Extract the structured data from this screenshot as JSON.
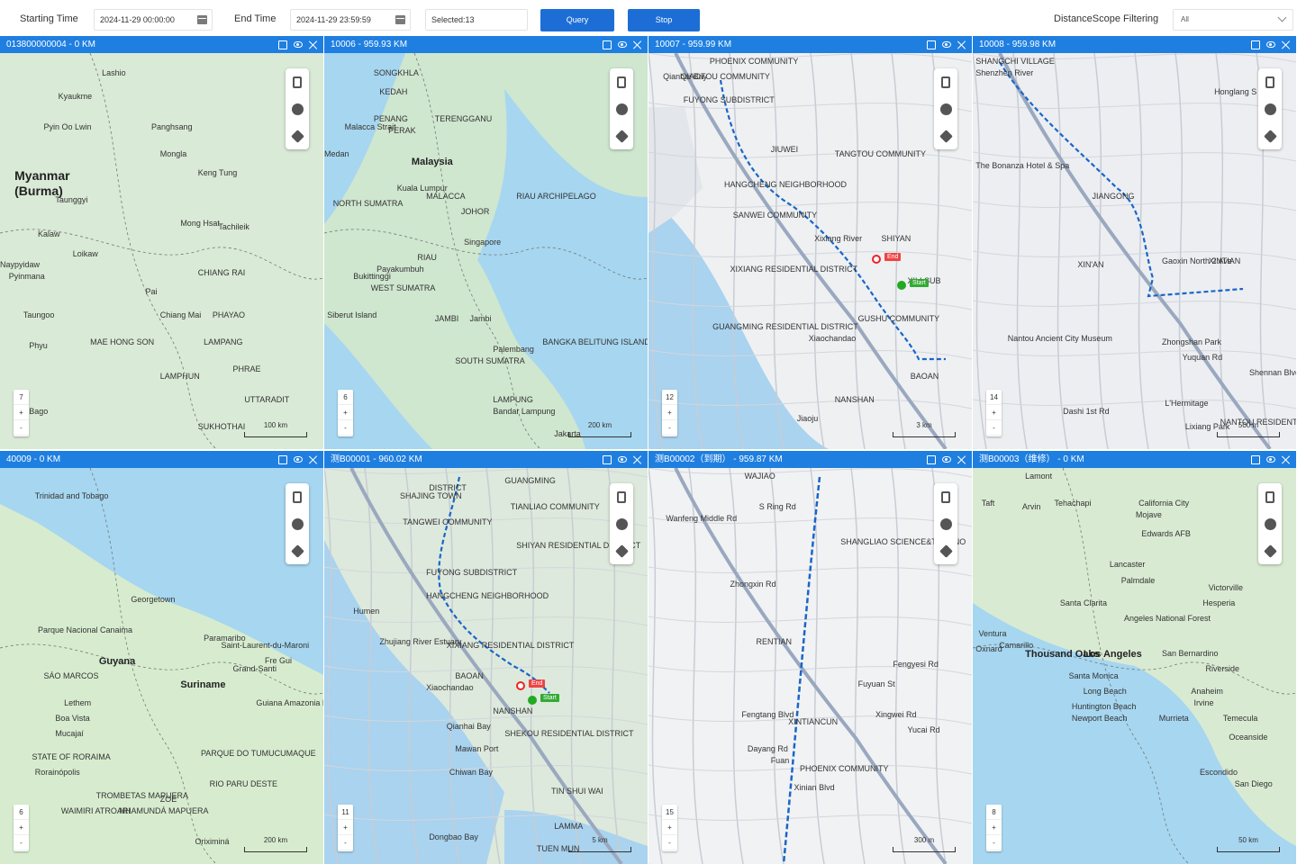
{
  "toolbar": {
    "start_label": "Starting Time",
    "start_value": "2024-11-29 00:00:00",
    "end_label": "End Time",
    "end_value": "2024-11-29 23:59:59",
    "selected": "Selected:13",
    "query": "Query",
    "stop": "Stop",
    "distance_label": "DistanceScope Filtering",
    "distance_value": "All"
  },
  "panels": [
    {
      "title": "013800000004 - 0 KM",
      "zoom": "7",
      "scale": "100 km",
      "labels": [
        "Myanmar",
        "(Burma)",
        "Lashio",
        "Kyaukme",
        "Pyin Oo Lwin",
        "Panghsang",
        "Mongla",
        "Keng Tung",
        "Taunggyi",
        "Mong Hsat",
        "Tachileik",
        "Kalaw",
        "Loikaw",
        "Naypyidaw",
        "Pyinmana",
        "CHIANG RAI",
        "Pai",
        "Chiang Mai",
        "PHAYAO",
        "Taungoo",
        "MAE HONG SON",
        "LAMPANG",
        "Phyu",
        "PHRAE",
        "LAMPHUN",
        "Bago",
        "UTTARADIT",
        "SUKHOTHAI"
      ]
    },
    {
      "title": "10006 - 959.93 KM",
      "zoom": "6",
      "scale": "200 km",
      "labels": [
        "Malaysia",
        "Kuala Lumpur",
        "Singapore",
        "Medan",
        "SONGKHLA",
        "KEDAH",
        "PENANG",
        "TERENGGANU",
        "PERAK",
        "NORTH SUMATRA",
        "MALACCA",
        "JOHOR",
        "RIAU ARCHIPELAGO",
        "RIAU",
        "Payakumbuh",
        "Bukittinggi",
        "WEST SUMATRA",
        "Siberut Island",
        "JAMBI",
        "Jambi",
        "Palembang",
        "BANGKA BELITUNG ISLANDS",
        "SOUTH SUMATRA",
        "LAMPUNG",
        "Bandar Lampung",
        "Jakarta",
        "Malacca Strait"
      ]
    },
    {
      "title": "10007 - 959.99 KM",
      "zoom": "12",
      "scale": "3 km",
      "labels": [
        "PHOENIX COMMUNITY",
        "QIAOTOU COMMUNITY",
        "FUYONG SUBDISTRICT",
        "HANGCHENG NEIGHBORHOOD",
        "JIUWEI",
        "TANGTOU COMMUNITY",
        "SANWEI COMMUNITY",
        "Xixiang River",
        "SHIYAN",
        "XIXIANG RESIDENTIAL DISTRICT",
        "XILI SUB",
        "GUSHU COMMUNITY",
        "GUANGMING RESIDENTIAL DISTRICT",
        "Xiaochandao",
        "BAOAN",
        "NANSHAN",
        "Jiaoju",
        "Qianhai Bay"
      ]
    },
    {
      "title": "10008 - 959.98 KM",
      "zoom": "14",
      "scale": "500 m",
      "labels": [
        "Shenzhen River",
        "SHANGCHI VILLAGE",
        "The Bonanza Hotel & Spa",
        "JIANGONG",
        "XIN'AN",
        "Gaoxin North 2 Ave",
        "XINTIAN",
        "Zhongshan Park",
        "Yuquan Rd",
        "Nantou Ancient City Museum",
        "L'Hermitage",
        "Shennan Blvd",
        "NANTOU RESIDENTIAL DISTRICT",
        "Lixiang Park",
        "Dashi 1st Rd",
        "Honglang S Rd"
      ]
    },
    {
      "title": "40009 - 0 KM",
      "zoom": "6",
      "scale": "200 km",
      "labels": [
        "Trinidad and Tobago",
        "Georgetown",
        "Paramaribo",
        "Guyana",
        "Suriname",
        "Parque Nacional Canaima",
        "Saint-Laurent-du-Maroni",
        "Fre Gui",
        "Grand-Santi",
        "Lethem",
        "Boa Vista",
        "Mucajaí",
        "STATE OF RORAIMA",
        "Rorainópolis",
        "PARQUE DO TUMUCUMAQUE",
        "RIO PARU DESTE",
        "TROMBETAS MAPUERA",
        "WAIMIRI ATROARI",
        "NHAMUNDÁ MAPUERA",
        "Oriximiná",
        "ZOE",
        "Guiana Amazonia Park",
        "SÁO MARCOS"
      ]
    },
    {
      "title": "测B00001 - 960.02 KM",
      "zoom": "11",
      "scale": "5 km",
      "labels": [
        "GUANGMING",
        "DISTRICT",
        "SHAJING TOWN",
        "TIANLIAO COMMUNITY",
        "TANGWEI COMMUNITY",
        "FUYONG SUBDISTRICT",
        "SHIYAN RESIDENTIAL DISTRICT",
        "Humen",
        "HANGCHENG NEIGHBORHOOD",
        "Zhujiang River Estuary",
        "XIXIANG RESIDENTIAL DISTRICT",
        "Xiaochandao",
        "BAOAN",
        "NANSHAN",
        "Qianhai Bay",
        "SHEKOU RESIDENTIAL DISTRICT",
        "Mawan Port",
        "Chiwan Bay",
        "TIN SHUI WAI",
        "LAMMA",
        "Dongbao Bay",
        "TUEN MUN"
      ]
    },
    {
      "title": "测B00002（到期） - 959.87 KM",
      "zoom": "15",
      "scale": "300 m",
      "labels": [
        "WAJIAO",
        "S Ring Rd",
        "Wanfeng Middle Rd",
        "SHANGLIAO SCIENCE&TECHNO",
        "Zhongxin Rd",
        "RENTIAN",
        "Fuyuan St",
        "Fengtang Blvd",
        "XINTIANCUN",
        "Xingwei Rd",
        "Dayang Rd",
        "Fuan",
        "PHOENIX COMMUNITY",
        "Xinian Blvd",
        "Fengyesi Rd",
        "Yucai Rd"
      ]
    },
    {
      "title": "测B00003（维修） - 0 KM",
      "zoom": "8",
      "scale": "50 km",
      "labels": [
        "Lamont",
        "Taft",
        "Arvin",
        "Tehachapi",
        "California City",
        "Mojave",
        "Edwards AFB",
        "Lancaster",
        "Palmdale",
        "Victorville",
        "Hesperia",
        "Santa Clarita",
        "Angeles National Forest",
        "Ventura",
        "Camarillo",
        "Oxnard",
        "Thousand Oaks",
        "Los Angeles",
        "San Bernardino",
        "Riverside",
        "Santa Monica",
        "Long Beach",
        "Anaheim",
        "Irvine",
        "Huntington Beach",
        "Newport Beach",
        "Murrieta",
        "Temecula",
        "Oceanside",
        "Escondido",
        "San Diego"
      ]
    }
  ],
  "route": {
    "end": "End",
    "start": "Start"
  }
}
